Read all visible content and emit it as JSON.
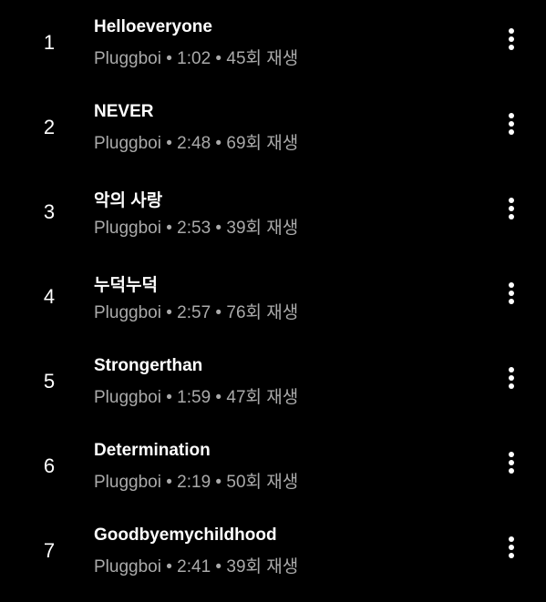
{
  "colors": {
    "background": "#000000",
    "title": "#ffffff",
    "meta": "#aaaaaa",
    "icon": "#ffffff"
  },
  "icons": {
    "more": "more-vert-icon"
  },
  "tracks": [
    {
      "number": "1",
      "title": "Helloeveryone",
      "artist": "Pluggboi",
      "duration": "1:02",
      "plays": "45회 재생"
    },
    {
      "number": "2",
      "title": "NEVER",
      "artist": "Pluggboi",
      "duration": "2:48",
      "plays": "69회 재생"
    },
    {
      "number": "3",
      "title": "악의 사랑",
      "artist": "Pluggboi",
      "duration": "2:53",
      "plays": "39회 재생"
    },
    {
      "number": "4",
      "title": "누덕누덕",
      "artist": "Pluggboi",
      "duration": "2:57",
      "plays": "76회 재생"
    },
    {
      "number": "5",
      "title": "Strongerthan",
      "artist": "Pluggboi",
      "duration": "1:59",
      "plays": "47회 재생"
    },
    {
      "number": "6",
      "title": "Determination",
      "artist": "Pluggboi",
      "duration": "2:19",
      "plays": "50회 재생"
    },
    {
      "number": "7",
      "title": "Goodbyemychildhood",
      "artist": "Pluggboi",
      "duration": "2:41",
      "plays": "39회 재생"
    }
  ]
}
